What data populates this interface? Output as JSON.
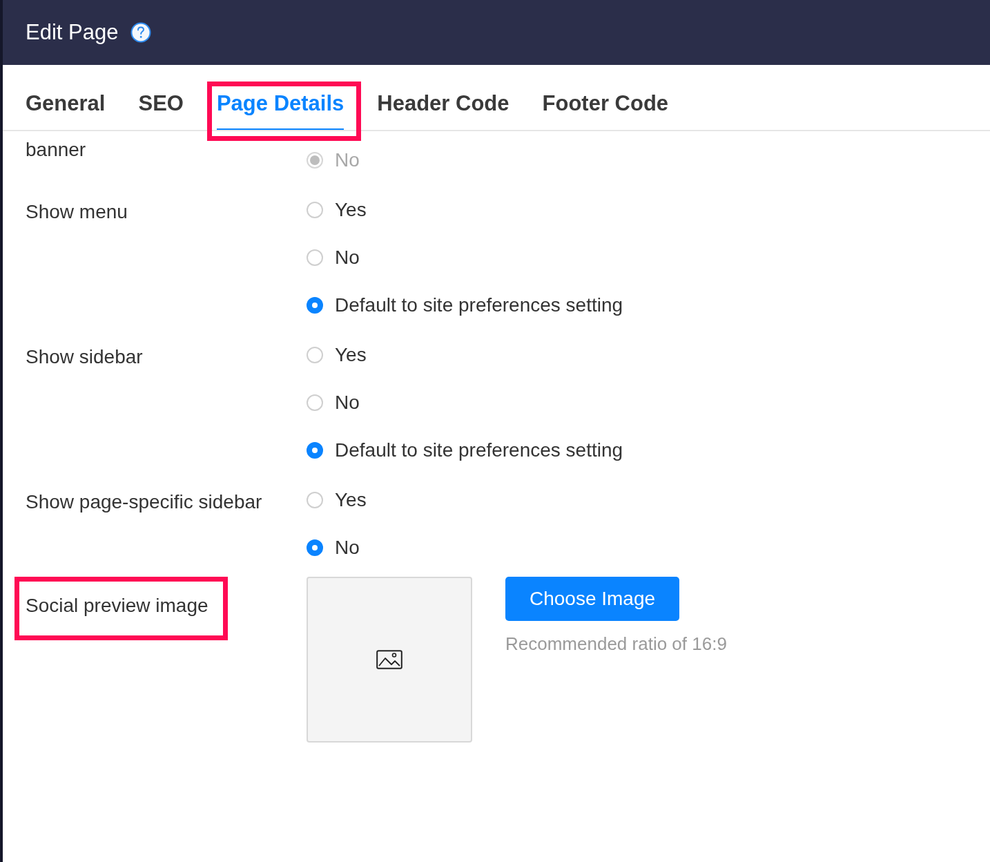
{
  "header": {
    "title": "Edit Page"
  },
  "tabs": [
    {
      "label": "General",
      "selected": false,
      "highlighted": false
    },
    {
      "label": "SEO",
      "selected": false,
      "highlighted": false
    },
    {
      "label": "Page Details",
      "selected": true,
      "highlighted": true
    },
    {
      "label": "Header Code",
      "selected": false,
      "highlighted": false
    },
    {
      "label": "Footer Code",
      "selected": false,
      "highlighted": false
    }
  ],
  "fields": [
    {
      "kind": "radio",
      "label": "banner",
      "highlighted": false,
      "options": [
        {
          "label": "No",
          "selected": true,
          "disabled": true
        }
      ]
    },
    {
      "kind": "radio",
      "label": "Show menu",
      "highlighted": false,
      "options": [
        {
          "label": "Yes",
          "selected": false,
          "disabled": false
        },
        {
          "label": "No",
          "selected": false,
          "disabled": false
        },
        {
          "label": "Default to site preferences setting",
          "selected": true,
          "disabled": false
        }
      ]
    },
    {
      "kind": "radio",
      "label": "Show sidebar",
      "highlighted": false,
      "options": [
        {
          "label": "Yes",
          "selected": false,
          "disabled": false
        },
        {
          "label": "No",
          "selected": false,
          "disabled": false
        },
        {
          "label": "Default to site preferences setting",
          "selected": true,
          "disabled": false
        }
      ]
    },
    {
      "kind": "radio",
      "label": "Show page-specific sidebar",
      "highlighted": false,
      "options": [
        {
          "label": "Yes",
          "selected": false,
          "disabled": false
        },
        {
          "label": "No",
          "selected": true,
          "disabled": false
        }
      ]
    },
    {
      "kind": "image",
      "label": "Social preview image",
      "highlighted": true,
      "button": "Choose Image",
      "hint": "Recommended ratio of 16:9"
    }
  ]
}
